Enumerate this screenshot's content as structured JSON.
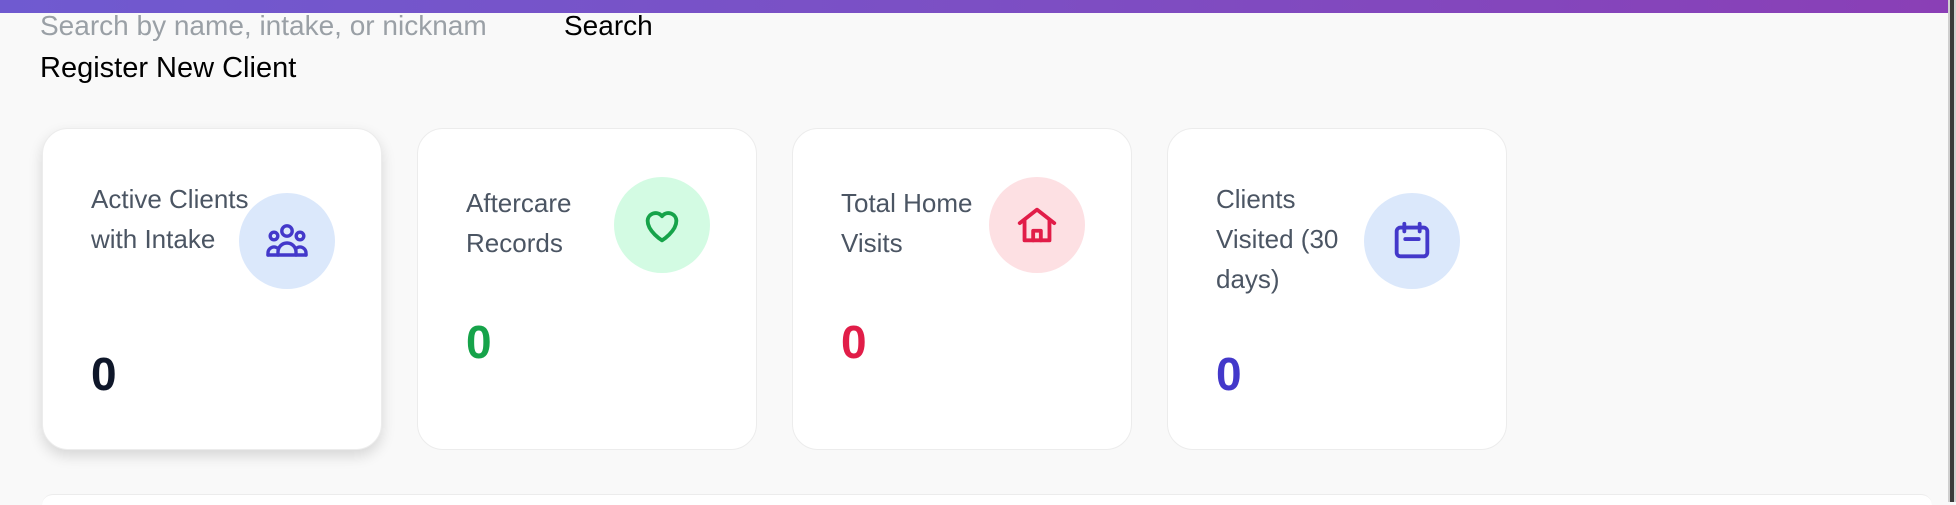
{
  "search": {
    "placeholder": "Search by name, intake, or nicknam",
    "button_label": "Search"
  },
  "register_label": "Register New Client",
  "colors": {
    "top_bar": [
      "#6f5ad0",
      "#8a3fb6"
    ],
    "blue": "#4338ca",
    "green": "#16a34a",
    "red": "#e11d48",
    "navy": "#0f172a"
  },
  "stats": [
    {
      "label": "Active Clients with Intake",
      "value": "0",
      "icon": "users-icon",
      "value_color": "#0f172a",
      "icon_color": "#4338ca",
      "icon_bg": "#dbe8fb"
    },
    {
      "label": "Aftercare Records",
      "value": "0",
      "icon": "heart-icon",
      "value_color": "#16a34a",
      "icon_color": "#16a34a",
      "icon_bg": "#d3fbe3"
    },
    {
      "label": "Total Home Visits",
      "value": "0",
      "icon": "home-icon",
      "value_color": "#e11d48",
      "icon_color": "#e11d48",
      "icon_bg": "#fde0e3"
    },
    {
      "label": "Clients Visited (30 days)",
      "value": "0",
      "icon": "calendar-icon",
      "value_color": "#4338ca",
      "icon_color": "#4338ca",
      "icon_bg": "#dbe8fb"
    }
  ]
}
